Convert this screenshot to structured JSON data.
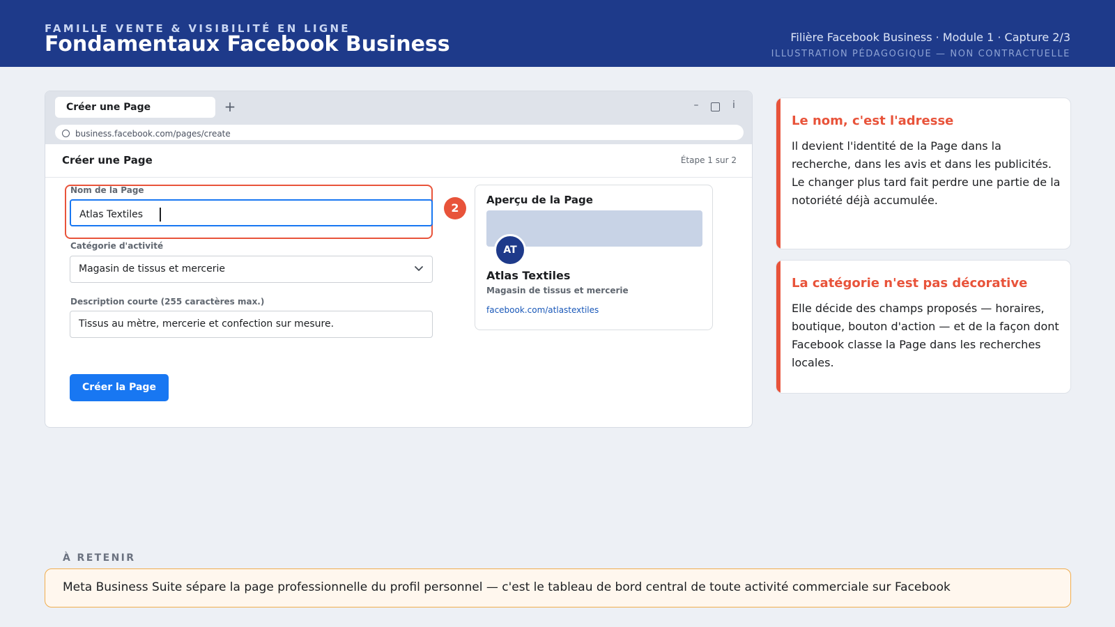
{
  "header": {
    "family": "FAMILLE VENTE & VISIBILITÉ EN LIGNE",
    "title": "Fondamentaux Facebook Business",
    "track": "Filière Facebook Business · Module 1 · Capture 2/3",
    "disclaimer": "ILLUSTRATION PÉDAGOGIQUE — NON CONTRACTUELLE"
  },
  "browser": {
    "tab_label": "Créer une Page",
    "new_tab": "+",
    "minimize": "–",
    "close": "i",
    "url": "business.facebook.com/pages/create"
  },
  "page": {
    "title": "Créer une Page",
    "step": "Étape 1 sur 2",
    "step_badge": "2",
    "fields": {
      "name_label": "Nom de la Page",
      "name_value": "Atlas Textiles",
      "category_label": "Catégorie d'activité",
      "category_value": "Magasin de tissus et mercerie",
      "description_label": "Description courte (255 caractères max.)",
      "description_value": "Tissus au mètre, mercerie et confection sur mesure."
    },
    "submit_label": "Créer la Page",
    "preview": {
      "title": "Aperçu de la Page",
      "avatar": "AT",
      "name": "Atlas Textiles",
      "category": "Magasin de tissus et mercerie",
      "url": "facebook.com/atlastextiles"
    }
  },
  "notes": [
    {
      "title": "Le nom, c'est l'adresse",
      "body": "Il devient l'identité de la Page dans la recherche, dans les avis et dans les publicités. Le changer plus tard fait perdre une partie de la notoriété déjà accumulée."
    },
    {
      "title": "La catégorie n'est pas décorative",
      "body": "Elle décide des champs proposés — horaires, boutique, bouton d'action — et de la façon dont Facebook classe la Page dans les recherches locales."
    }
  ],
  "retain": {
    "label": "À RETENIR",
    "text": "Meta Business Suite sépare la page professionnelle du profil personnel — c'est le tableau de bord central de toute activité commerciale sur Facebook"
  },
  "colors": {
    "header_bg": "#1e3a8a",
    "accent": "#e8533a",
    "facebook_blue": "#1877f2",
    "retain_border": "#f0ad4e"
  },
  "icons": [
    "new-tab-icon",
    "minimize-icon",
    "maximize-icon",
    "close-icon",
    "site-info-icon",
    "chevron-down-icon"
  ]
}
